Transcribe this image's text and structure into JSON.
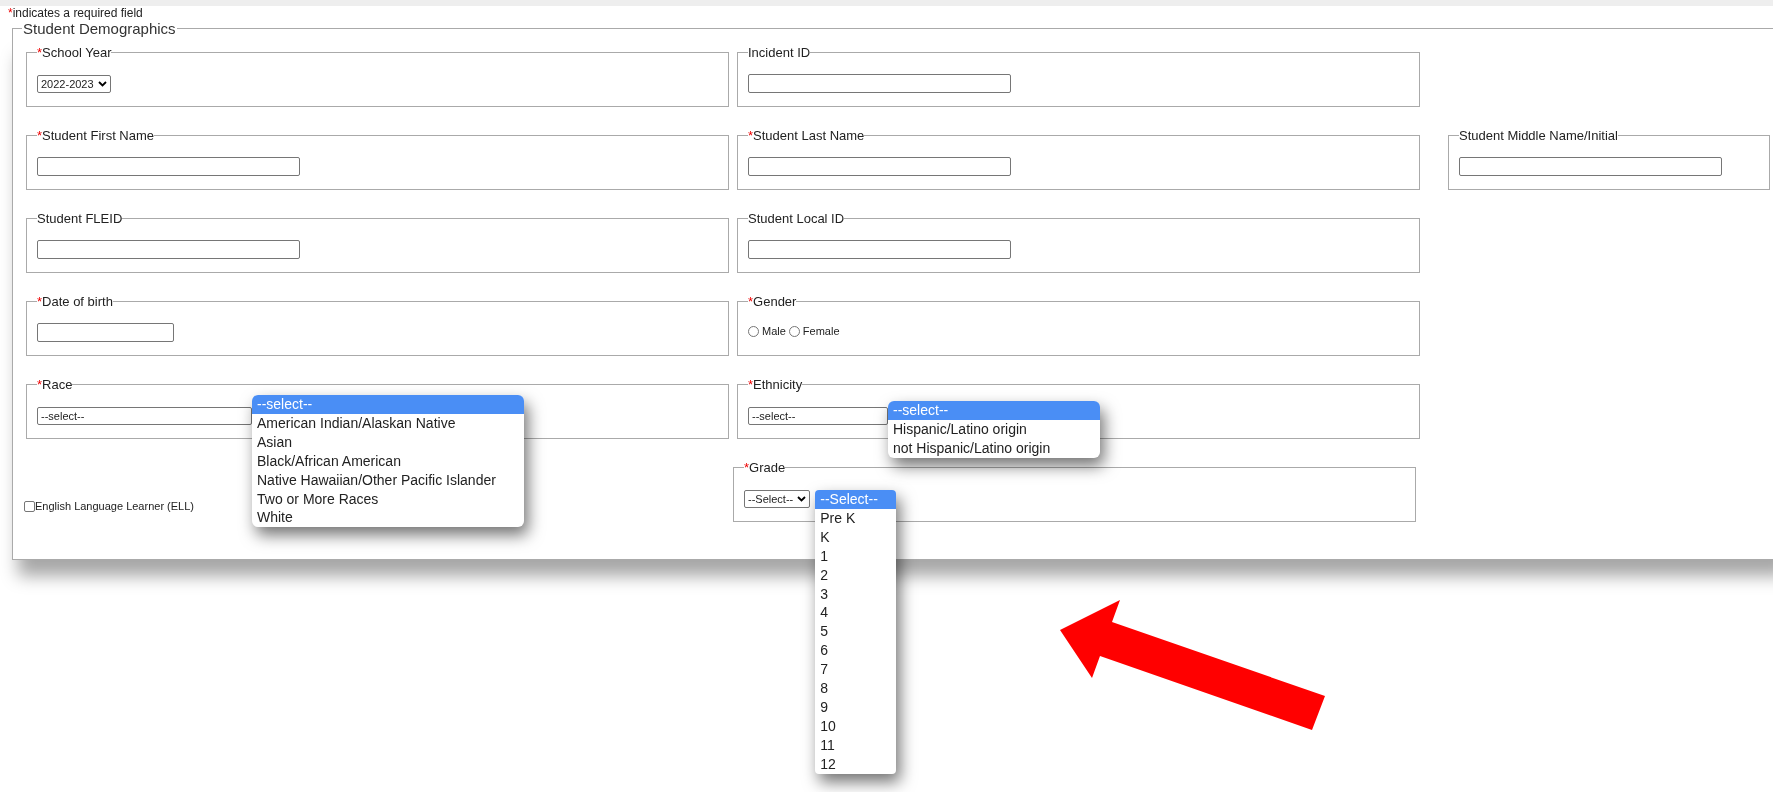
{
  "required_mark": "*",
  "required_note": "indicates a required field",
  "section": {
    "title": "Student Demographics",
    "rows": [
      [
        {
          "kind": "select",
          "label": "School Year",
          "required": true,
          "value": "2022-2023"
        },
        {
          "kind": "text",
          "label": "Incident ID",
          "required": false
        }
      ],
      [
        {
          "kind": "text",
          "label": "Student First Name",
          "required": true
        },
        {
          "kind": "text",
          "label": "Student Last Name",
          "required": true
        },
        {
          "kind": "text",
          "label": "Student Middle Name/Initial",
          "required": false
        }
      ],
      [
        {
          "kind": "text",
          "label": "Student FLEID",
          "required": false
        },
        {
          "kind": "text",
          "label": "Student Local ID",
          "required": false
        }
      ],
      [
        {
          "kind": "date",
          "label": "Date of birth",
          "required": true
        },
        {
          "kind": "radio",
          "label": "Gender",
          "required": true,
          "options": [
            {
              "label": "Male",
              "selected": false
            },
            {
              "label": "Female",
              "selected": false
            }
          ]
        }
      ],
      [
        {
          "kind": "select",
          "label": "Race",
          "required": true,
          "value": "--select--",
          "open_options": [
            {
              "label": "--select--",
              "selected": true
            },
            {
              "label": "American Indian/Alaskan Native",
              "selected": false
            },
            {
              "label": "Asian",
              "selected": false
            },
            {
              "label": "Black/African American",
              "selected": false
            },
            {
              "label": "Native Hawaiian/Other Pacific Islander",
              "selected": false
            },
            {
              "label": "Two or More Races",
              "selected": false
            },
            {
              "label": "White",
              "selected": false
            }
          ]
        },
        {
          "kind": "select",
          "label": "Ethnicity",
          "required": true,
          "value": "--select--",
          "open_options": [
            {
              "label": "--select--",
              "selected": true
            },
            {
              "label": "Hispanic/Latino origin",
              "selected": false
            },
            {
              "label": "not Hispanic/Latino origin",
              "selected": false
            }
          ]
        }
      ],
      [
        {
          "kind": "checkbox",
          "label": "English Language Learner (ELL)",
          "checked": false
        },
        {
          "kind": "select",
          "label": "Grade",
          "required": true,
          "value": "--Select--",
          "open_options": [
            {
              "label": "--Select--",
              "selected": true
            },
            {
              "label": "Pre K",
              "selected": false
            },
            {
              "label": "K",
              "selected": false
            },
            {
              "label": "1",
              "selected": false
            },
            {
              "label": "2",
              "selected": false
            },
            {
              "label": "3",
              "selected": false
            },
            {
              "label": "4",
              "selected": false
            },
            {
              "label": "5",
              "selected": false
            },
            {
              "label": "6",
              "selected": false
            },
            {
              "label": "7",
              "selected": false
            },
            {
              "label": "8",
              "selected": false
            },
            {
              "label": "9",
              "selected": false
            },
            {
              "label": "10",
              "selected": false
            },
            {
              "label": "11",
              "selected": false
            },
            {
              "label": "12",
              "selected": false
            }
          ]
        }
      ]
    ]
  }
}
